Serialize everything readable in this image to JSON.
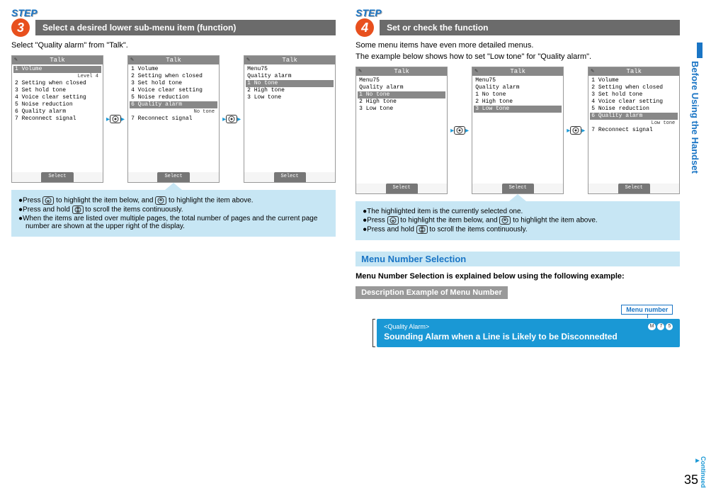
{
  "page_number": "35",
  "side_tab": "Before Using the Handset",
  "continued_label": "Continued",
  "left": {
    "step_label": "STEP",
    "step_num": "3",
    "step_title": "Select a desired lower sub-menu item (function)",
    "instruction": "Select \"Quality alarm\" from \"Talk\".",
    "screens": [
      {
        "title": "Talk",
        "header": null,
        "items": [
          "1 Volume",
          "2 Setting when closed",
          "3 Set hold tone",
          "4 Voice clear setting",
          "5 Noise reduction",
          "6 Quality alarm",
          "7 Reconnect signal"
        ],
        "sel_index": 0,
        "subtext": "Level 4",
        "softkey": "Select"
      },
      {
        "title": "Talk",
        "header": null,
        "items": [
          "1 Volume",
          "2 Setting when closed",
          "3 Set hold tone",
          "4 Voice clear setting",
          "5 Noise reduction",
          "6 Quality alarm",
          "7 Reconnect signal"
        ],
        "sel_index": 5,
        "subtext": "No tone",
        "softkey": "Select"
      },
      {
        "title": "Talk",
        "header": "Menu75\nQuality alarm",
        "items": [
          "1 No tone",
          "2 High tone",
          "3 Low tone"
        ],
        "sel_index": 0,
        "subtext": null,
        "softkey": "Select"
      }
    ],
    "tips": [
      "Press (down) to highlight the item below, and (up) to highlight the item above.",
      "Press and hold (nav) to scroll the items continuously.",
      "When the items are listed over multiple pages, the total number of pages and the current page number are shown at the upper right of the display."
    ]
  },
  "right": {
    "step_label": "STEP",
    "step_num": "4",
    "step_title": "Set or check the function",
    "instruction1": "Some menu items have even more detailed menus.",
    "instruction2": "The example below shows how to set \"Low tone\" for \"Quality alarm\".",
    "screens": [
      {
        "title": "Talk",
        "header": "Menu75\nQuality alarm",
        "items": [
          "1 No tone",
          "2 High tone",
          "3 Low tone"
        ],
        "sel_index": 0,
        "subtext": null,
        "softkey": "Select"
      },
      {
        "title": "Talk",
        "header": "Menu75\nQuality alarm",
        "items": [
          "1 No tone",
          "2 High tone",
          "3 Low tone"
        ],
        "sel_index": 2,
        "subtext": null,
        "softkey": "Select"
      },
      {
        "title": "Talk",
        "header": null,
        "items": [
          "1 Volume",
          "2 Setting when closed",
          "3 Set hold tone",
          "4 Voice clear setting",
          "5 Noise reduction",
          "6 Quality alarm",
          "7 Reconnect signal"
        ],
        "sel_index": 5,
        "subtext": "Low tone",
        "softkey": "Select"
      }
    ],
    "tips": [
      "The highlighted item is the currently selected one.",
      "Press (down) to highlight the item below, and (up) to highlight the item above.",
      "Press and hold (nav) to scroll the items continuously."
    ],
    "menu_sel_title": "Menu Number Selection",
    "menu_sel_line": "Menu Number Selection is explained below using the following example:",
    "desc_bar": "Description Example of Menu Number",
    "menu_num_label": "Menu number",
    "example_qa": "<Quality Alarm>",
    "example_keys": [
      "M",
      "7",
      "5"
    ],
    "example_main": "Sounding Alarm when a Line is Likely to be Disconnedted"
  }
}
